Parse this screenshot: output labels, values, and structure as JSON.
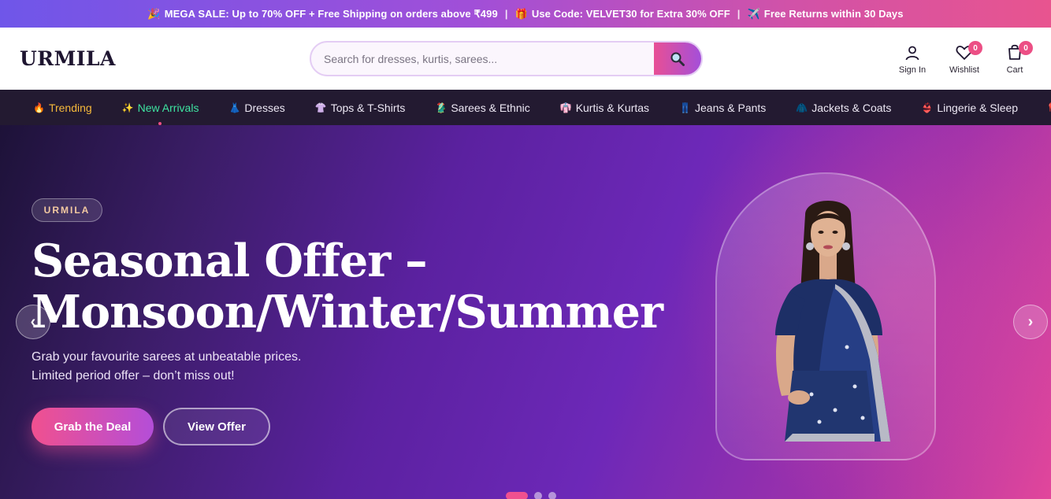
{
  "promo": {
    "item1_icon": "🎉",
    "item1_text": "MEGA SALE: Up to 70% OFF + Free Shipping on orders above ₹499",
    "sep1": "|",
    "item2_icon": "🎁",
    "item2_text": "Use Code: VELVET30 for Extra 30% OFF",
    "sep2": "|",
    "item3_icon": "✈️",
    "item3_text": "Free Returns within 30 Days"
  },
  "header": {
    "logo": "URMILA",
    "search_placeholder": "Search for dresses, kurtis, sarees...",
    "sign_in": "Sign In",
    "wishlist": "Wishlist",
    "wishlist_count": "0",
    "cart": "Cart",
    "cart_count": "0"
  },
  "categories": [
    {
      "icon": "🔥",
      "label": "Trending"
    },
    {
      "icon": "✨",
      "label": "New Arrivals"
    },
    {
      "icon": "👗",
      "label": "Dresses"
    },
    {
      "icon": "👚",
      "label": "Tops & T-Shirts"
    },
    {
      "icon": "🥻",
      "label": "Sarees & Ethnic"
    },
    {
      "icon": "👘",
      "label": "Kurtis & Kurtas"
    },
    {
      "icon": "👖",
      "label": "Jeans & Pants"
    },
    {
      "icon": "🧥",
      "label": "Jackets & Coats"
    },
    {
      "icon": "👙",
      "label": "Lingerie & Sleep"
    },
    {
      "icon": "👠",
      "label": ""
    }
  ],
  "hero": {
    "brand": "URMILA",
    "title_line1": "Seasonal Offer –",
    "title_line2": "Monsoon/Winter/Summer",
    "subtitle_line1": "Grab your favourite sarees at unbeatable prices.",
    "subtitle_line2": "Limited period offer – don’t miss out!",
    "primary_button": "Grab the Deal",
    "secondary_button": "View Offer",
    "prev": "‹",
    "next": "›",
    "slide_count": 3,
    "active_slide": 1
  },
  "colors": {
    "accent_pink": "#f0508f",
    "accent_purple": "#a44fd9",
    "nav_bg": "#231a31",
    "trending": "#f6b93b",
    "new_arrivals": "#3ee4a1"
  }
}
